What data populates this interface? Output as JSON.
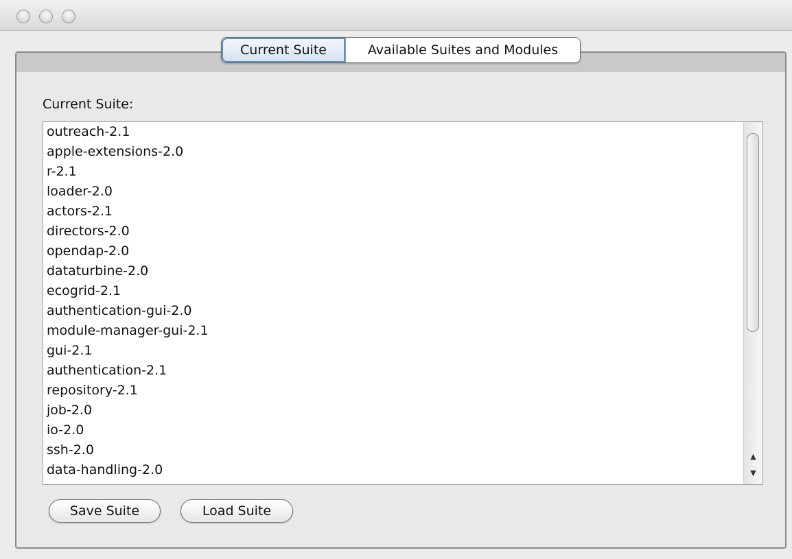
{
  "window": {
    "traffic_lights": [
      "close",
      "minimize",
      "zoom"
    ]
  },
  "tabs": [
    {
      "label": "Current Suite",
      "active": true
    },
    {
      "label": "Available Suites and Modules",
      "active": false
    }
  ],
  "current_suite": {
    "label": "Current Suite:",
    "items": [
      "outreach-2.1",
      "apple-extensions-2.0",
      "r-2.1",
      "loader-2.0",
      "actors-2.1",
      "directors-2.0",
      "opendap-2.0",
      "dataturbine-2.0",
      "ecogrid-2.1",
      "authentication-gui-2.0",
      "module-manager-gui-2.1",
      "gui-2.1",
      "authentication-2.1",
      "repository-2.1",
      "job-2.0",
      "io-2.0",
      "ssh-2.0",
      "data-handling-2.0"
    ]
  },
  "buttons": {
    "save_label": "Save Suite",
    "load_label": "Load Suite"
  },
  "icons": {
    "scroll_up": "scroll-up-arrow-icon",
    "scroll_down": "scroll-down-arrow-icon"
  },
  "colors": {
    "active_tab_border": "#5d8fc8",
    "window_bg": "#ececec"
  }
}
